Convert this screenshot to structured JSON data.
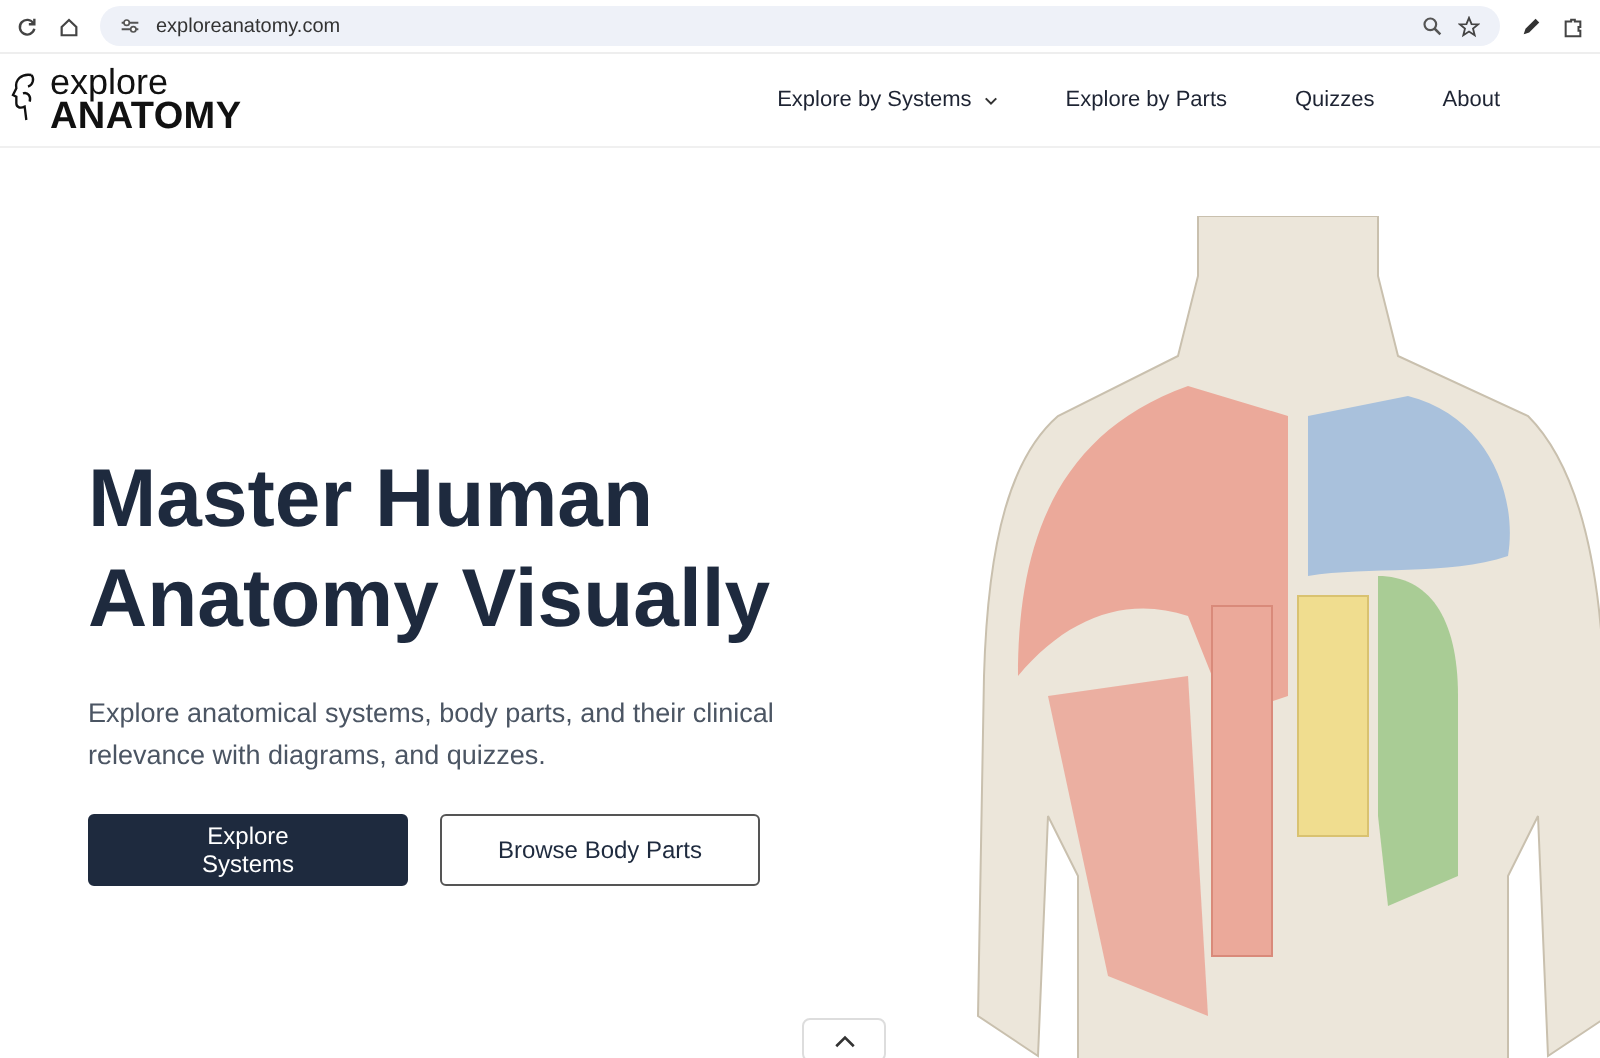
{
  "browser": {
    "url": "exploreanatomy.com"
  },
  "logo": {
    "line_1": "explore",
    "line_2": "ANATOMY"
  },
  "nav": [
    {
      "label": "Explore by Systems",
      "kind": "dropdown"
    },
    {
      "label": "Explore by Parts",
      "kind": "link"
    },
    {
      "label": "Quizzes",
      "kind": "link"
    },
    {
      "label": "About",
      "kind": "link"
    }
  ],
  "hero": {
    "title": "Master Human Anatomy Visually",
    "subtitle": "Explore anatomical systems, body parts, and their clinical relevance with diagrams, and quizzes.",
    "buttons": [
      {
        "label": "Explore Systems",
        "kind": "primary"
      },
      {
        "label": "Browse Body Parts",
        "kind": "secondary"
      }
    ]
  }
}
